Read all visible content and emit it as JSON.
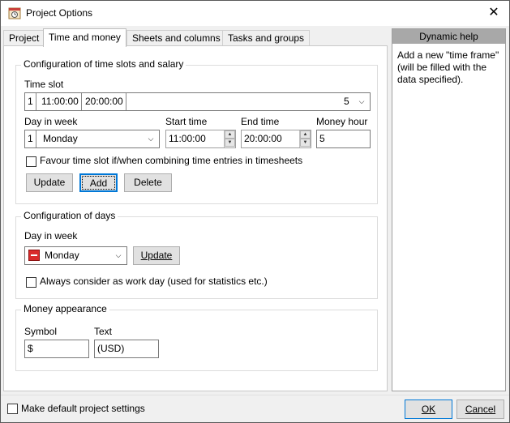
{
  "window": {
    "title": "Project Options",
    "close_glyph": "✕"
  },
  "tabs": [
    {
      "label": "Project"
    },
    {
      "label": "Time and money"
    },
    {
      "label": "Sheets and columns"
    },
    {
      "label": "Tasks and groups"
    }
  ],
  "time_slots": {
    "group_title": "Configuration of time slots and salary",
    "time_slot_label": "Time slot",
    "time_slot_value": {
      "num": "1",
      "start": "11:00:00",
      "end": "20:00:00",
      "count": "5"
    },
    "day_label": "Day in week",
    "day_value": {
      "num": "1",
      "name": "Monday"
    },
    "start_label": "Start time",
    "start_value": "11:00:00",
    "end_label": "End time",
    "end_value": "20:00:00",
    "money_label": "Money hour",
    "money_value": "5",
    "favour_label": "Favour time slot if/when combining time entries in timesheets",
    "favour_checked": false,
    "update_button": "Update",
    "add_button": "Add",
    "delete_button": "Delete"
  },
  "days": {
    "group_title": "Configuration of days",
    "day_label": "Day in week",
    "day_value": "Monday",
    "update_button": "Update",
    "workday_label": "Always consider as work day (used for statistics etc.)",
    "workday_checked": false
  },
  "money": {
    "group_title": "Money appearance",
    "symbol_label": "Symbol",
    "symbol_value": "$",
    "text_label": "Text",
    "text_value": "(USD)"
  },
  "help": {
    "title": "Dynamic help",
    "body": "Add a new \"time frame\" (will be filled with the data specified)."
  },
  "footer": {
    "default_label": "Make default project settings",
    "default_checked": false,
    "ok_button": "OK",
    "cancel_button": "Cancel"
  },
  "colors": {
    "focus": "#0078d7",
    "help_header": "#a8a8a8",
    "flag": "#d92b2b"
  }
}
